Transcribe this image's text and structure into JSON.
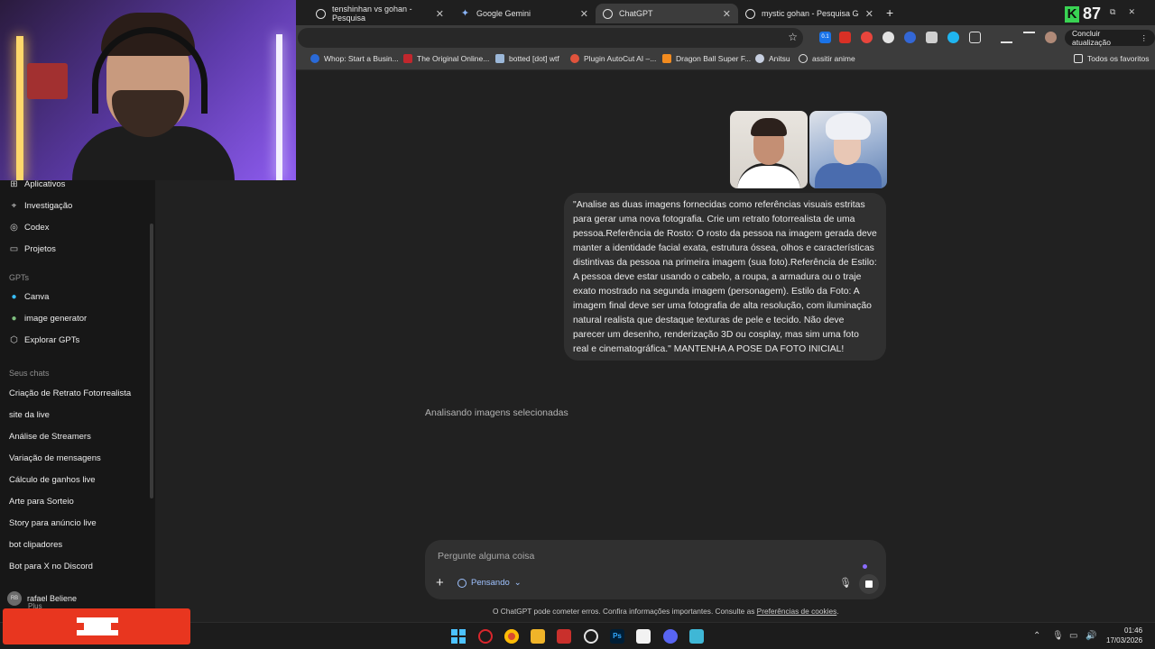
{
  "browser": {
    "tabs": [
      {
        "label": "tenshinhan vs gohan - Pesquisa"
      },
      {
        "label": "Google Gemini"
      },
      {
        "label": "ChatGPT"
      },
      {
        "label": "mystic gohan - Pesquisa Googl"
      }
    ],
    "new_tab_label": "+",
    "profile_counter": "87",
    "update_button": "Concluir atualização",
    "bookmarks": [
      {
        "label": "Whop: Start a Busin..."
      },
      {
        "label": "The Original Online..."
      },
      {
        "label": "botted [dot] wtf"
      },
      {
        "label": "Plugin AutoCut AI –..."
      },
      {
        "label": "Dragon Ball Super F..."
      },
      {
        "label": "Anitsu"
      },
      {
        "label": "assitir anime"
      }
    ],
    "all_favorites": "Todos os favoritos",
    "ext_badge": "0.1"
  },
  "sidebar": {
    "nav": [
      {
        "label": "Aplicativos",
        "icon": "grid-icon"
      },
      {
        "label": "Investigação",
        "icon": "telescope-icon"
      },
      {
        "label": "Codex",
        "icon": "codex-icon"
      },
      {
        "label": "Projetos",
        "icon": "folder-icon"
      }
    ],
    "gpts_heading": "GPTs",
    "gpts": [
      {
        "label": "Canva"
      },
      {
        "label": "image generator"
      },
      {
        "label": "Explorar GPTs"
      }
    ],
    "chats_heading": "Seus chats",
    "chats": [
      "Criação de Retrato Fotorrealista",
      "site da live",
      "Análise de Streamers",
      "Variação de mensagens",
      "Cálculo de ganhos live",
      "Arte para Sorteio",
      "Story para anúncio live",
      "bot clipadores",
      "Bot para X no Discord"
    ],
    "user": {
      "name": "rafael Beliene",
      "plan": "Plus",
      "initials": "RB"
    }
  },
  "main": {
    "prompt": "\"Analise as duas imagens fornecidas como referências visuais estritas para gerar uma nova fotografia. Crie um retrato fotorrealista de uma pessoa.Referência de Rosto: O rosto da pessoa na imagem gerada deve manter a identidade facial exata, estrutura óssea, olhos e características distintivas da pessoa na primeira imagem (sua foto).Referência de Estilo: A pessoa deve estar usando o cabelo, a roupa, a armadura ou o traje exato mostrado na segunda imagem (personagem). Estilo da Foto: A imagem final deve ser uma fotografia de alta resolução, com iluminação natural realista que destaque texturas de pele e tecido. Não deve parecer um desenho, renderização 3D ou cosplay, mas sim uma foto real e cinematográfica.\" MANTENHA A POSE DA FOTO INICIAL!",
    "status": "Analisando imagens selecionadas",
    "composer": {
      "placeholder": "Pergunte alguma coisa",
      "mode": "Pensando"
    },
    "footer_text": "O ChatGPT pode cometer erros. Confira informações importantes. Consulte as ",
    "footer_link": "Preferências de cookies",
    "footer_end": "."
  },
  "taskbar": {
    "time": "01:46",
    "date": "17/03/2026"
  },
  "colors": {
    "sidebar_bg": "#171717",
    "main_bg": "#212121",
    "bubble_bg": "#303030",
    "accent_blue": "#9fc2ff",
    "overlay_orange": "#e8361f"
  }
}
